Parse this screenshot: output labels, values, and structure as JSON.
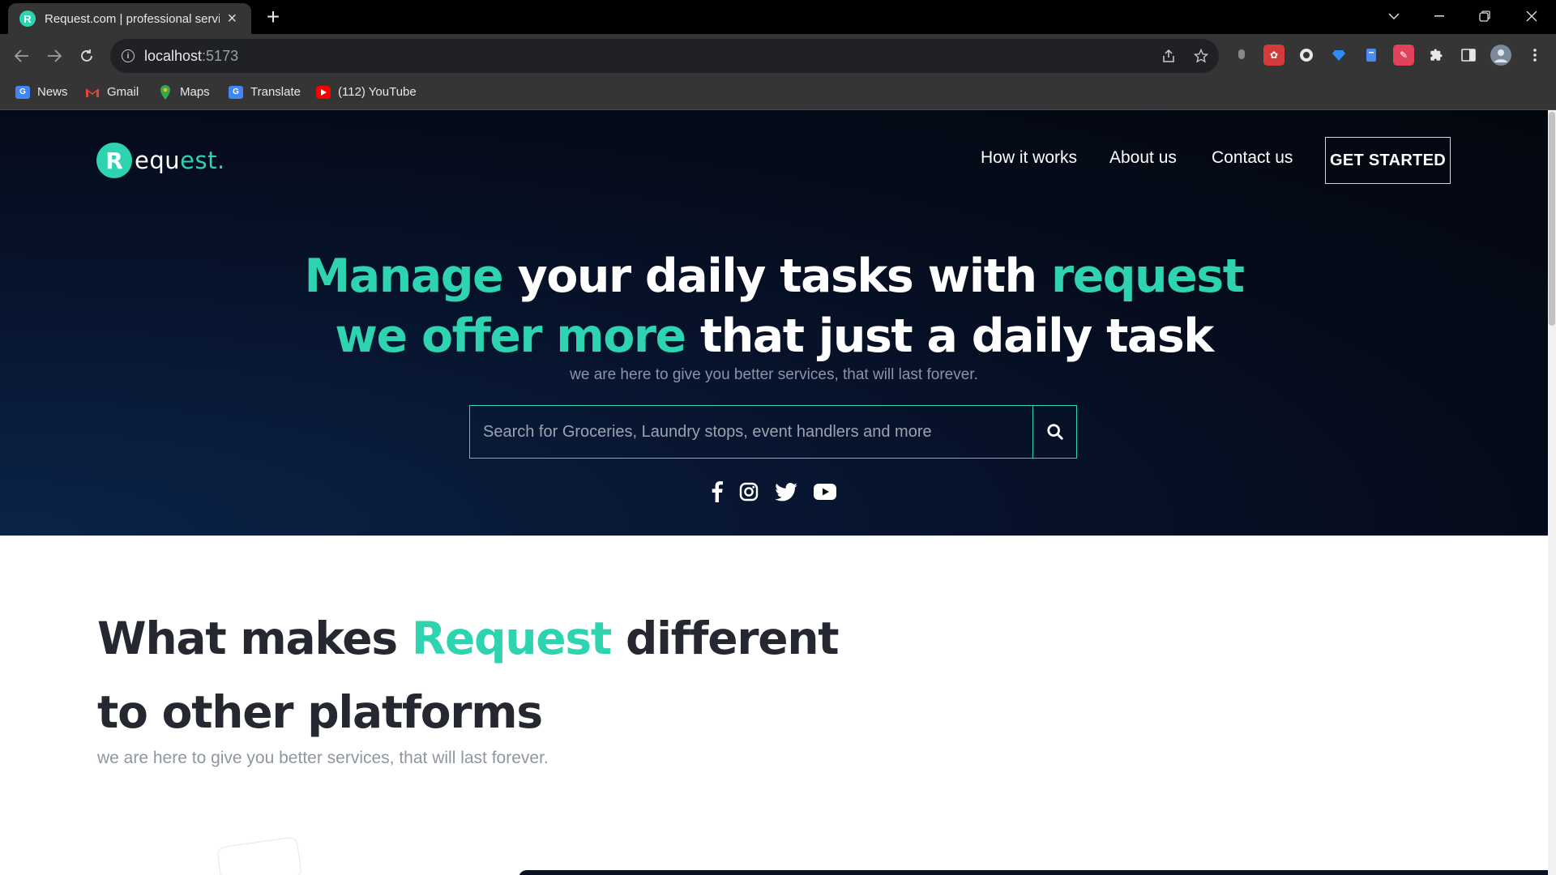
{
  "browser": {
    "tab_title": "Request.com | professional servic",
    "url_host": "localhost",
    "url_port": ":5173",
    "bookmarks": [
      {
        "label": "News",
        "icon": "google-news-icon"
      },
      {
        "label": "Gmail",
        "icon": "gmail-icon"
      },
      {
        "label": "Maps",
        "icon": "maps-icon"
      },
      {
        "label": "Translate",
        "icon": "translate-icon"
      },
      {
        "label": "(112) YouTube",
        "icon": "youtube-icon"
      }
    ]
  },
  "header": {
    "logo_part1": "equ",
    "logo_part2": "est.",
    "nav": [
      "How it works",
      "About us",
      "Contact us"
    ],
    "cta": "GET STARTED"
  },
  "hero": {
    "line1_accent": "Manage",
    "line1_rest": " your daily tasks with ",
    "line1_accent2": "request",
    "line2_accent": "we offer more",
    "line2_rest": " that just a daily task",
    "subtitle": "we are here to give you better services, that will last forever.",
    "search_placeholder": "Search for Groceries, Laundry stops, event handlers and more",
    "socials": [
      "facebook-icon",
      "instagram-icon",
      "twitter-icon",
      "youtube-icon"
    ]
  },
  "section": {
    "title_a": "What makes ",
    "title_accent": "Request",
    "title_b": " different",
    "title_line2": "to other platforms",
    "subtitle": "we are here to give you better services, that will last forever."
  },
  "colors": {
    "accent": "#2ed3b0",
    "hero_bg": "#050b1a",
    "heading_dark": "#252830"
  }
}
